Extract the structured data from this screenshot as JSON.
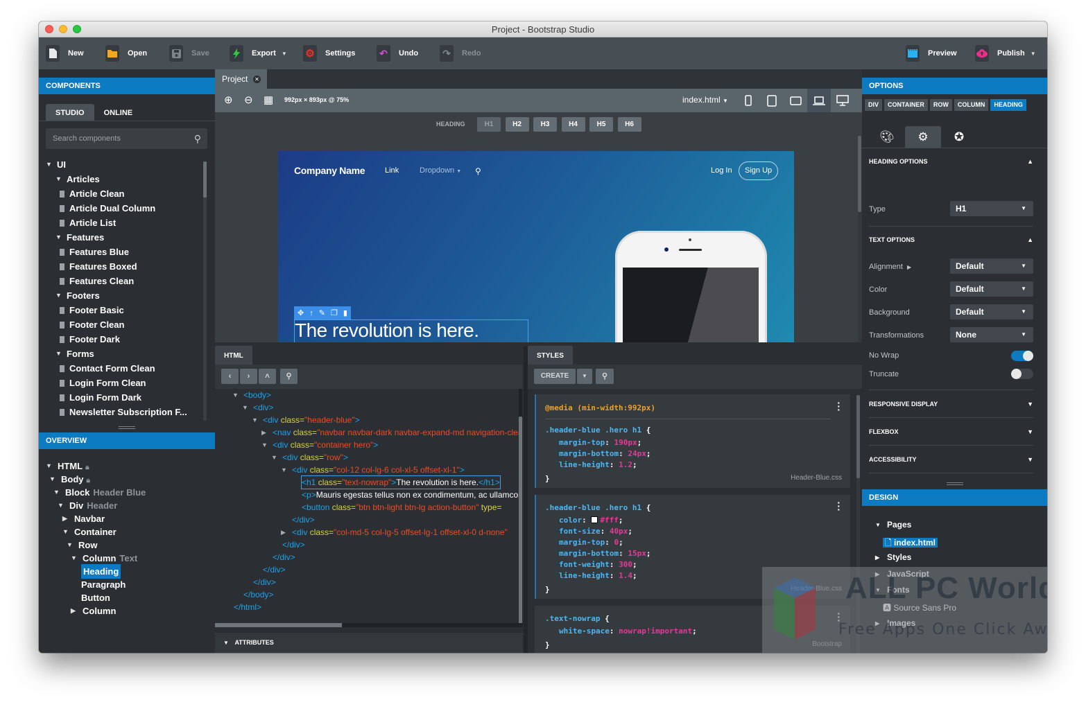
{
  "window": {
    "title": "Project - Bootstrap Studio"
  },
  "toolbar": {
    "new": "New",
    "open": "Open",
    "save": "Save",
    "export": "Export",
    "settings": "Settings",
    "undo": "Undo",
    "redo": "Redo",
    "preview": "Preview",
    "publish": "Publish",
    "colors": {
      "open": "#f5a623",
      "export": "#2ecc40",
      "settings": "#e8332a",
      "undo": "#d24bd6",
      "preview": "#2ab1f0",
      "publish": "#ec2f8b"
    }
  },
  "components": {
    "header": "COMPONENTS",
    "tabs": [
      "STUDIO",
      "ONLINE"
    ],
    "active_tab": "STUDIO",
    "search_placeholder": "Search components",
    "tree": [
      {
        "label": "UI",
        "level": 0,
        "type": "group"
      },
      {
        "label": "Articles",
        "level": 1,
        "type": "group"
      },
      {
        "label": "Article Clean",
        "level": 2,
        "type": "item"
      },
      {
        "label": "Article Dual Column",
        "level": 2,
        "type": "item"
      },
      {
        "label": "Article List",
        "level": 2,
        "type": "item"
      },
      {
        "label": "Features",
        "level": 1,
        "type": "group"
      },
      {
        "label": "Features Blue",
        "level": 2,
        "type": "item"
      },
      {
        "label": "Features Boxed",
        "level": 2,
        "type": "item"
      },
      {
        "label": "Features Clean",
        "level": 2,
        "type": "item"
      },
      {
        "label": "Footers",
        "level": 1,
        "type": "group"
      },
      {
        "label": "Footer Basic",
        "level": 2,
        "type": "item"
      },
      {
        "label": "Footer Clean",
        "level": 2,
        "type": "item"
      },
      {
        "label": "Footer Dark",
        "level": 2,
        "type": "item"
      },
      {
        "label": "Forms",
        "level": 1,
        "type": "group"
      },
      {
        "label": "Contact Form Clean",
        "level": 2,
        "type": "item"
      },
      {
        "label": "Login Form Clean",
        "level": 2,
        "type": "item"
      },
      {
        "label": "Login Form Dark",
        "level": 2,
        "type": "item"
      },
      {
        "label": "Newsletter Subscription F...",
        "level": 2,
        "type": "item"
      }
    ]
  },
  "overview": {
    "header": "OVERVIEW",
    "tree": [
      {
        "label": "HTML",
        "sub": "",
        "lock": true,
        "arrow": "down"
      },
      {
        "label": "Body",
        "sub": "",
        "lock": true,
        "arrow": "down"
      },
      {
        "label": "Block",
        "sub": "Header Blue",
        "lock": false,
        "arrow": "down"
      },
      {
        "label": "Div",
        "sub": "Header",
        "lock": false,
        "arrow": "down"
      },
      {
        "label": "Navbar",
        "sub": "",
        "lock": false,
        "arrow": "right"
      },
      {
        "label": "Container",
        "sub": "",
        "lock": false,
        "arrow": "down"
      },
      {
        "label": "Row",
        "sub": "",
        "lock": false,
        "arrow": "down"
      },
      {
        "label": "Column",
        "sub": "Text",
        "lock": false,
        "arrow": "down"
      },
      {
        "label": "Heading",
        "sub": "",
        "lock": false,
        "arrow": "",
        "selected": true
      },
      {
        "label": "Paragraph",
        "sub": "",
        "lock": false,
        "arrow": ""
      },
      {
        "label": "Button",
        "sub": "",
        "lock": false,
        "arrow": ""
      },
      {
        "label": "Column",
        "sub": "",
        "lock": false,
        "arrow": "right"
      }
    ]
  },
  "editor": {
    "doc_tab": "Project",
    "canvas_size": "992px × 893px @ 75%",
    "page_select": "index.html",
    "devices": [
      "phone",
      "tablet-portrait",
      "tablet-landscape",
      "laptop",
      "desktop"
    ],
    "active_device": "laptop",
    "heading_label": "HEADING",
    "heading_buttons": [
      "H1",
      "H2",
      "H3",
      "H4",
      "H5",
      "H6"
    ],
    "current_heading": "H1"
  },
  "preview": {
    "brand": "Company Name",
    "nav_links": [
      "Link",
      "Dropdown"
    ],
    "login": "Log In",
    "signup": "Sign Up",
    "headline": "The revolution is here.",
    "gradient": [
      "#1c3c85",
      "#1f8ab0"
    ]
  },
  "html_panel": {
    "tab": "HTML",
    "lines": [
      {
        "indent": 0,
        "arrow": "down",
        "parts": [
          [
            "tg",
            "<body>"
          ]
        ]
      },
      {
        "indent": 1,
        "arrow": "down",
        "parts": [
          [
            "tg",
            "<div>"
          ]
        ]
      },
      {
        "indent": 2,
        "arrow": "down",
        "parts": [
          [
            "tg",
            "<div "
          ],
          [
            "at",
            "class="
          ],
          [
            "av",
            "\"header-blue\""
          ],
          [
            "tg",
            ">"
          ]
        ]
      },
      {
        "indent": 3,
        "arrow": "right",
        "parts": [
          [
            "tg",
            "<nav "
          ],
          [
            "at",
            "class="
          ],
          [
            "av",
            "\"navbar navbar-dark navbar-expand-md navigation-clean-search\""
          ],
          [
            "tg",
            ">"
          ]
        ]
      },
      {
        "indent": 3,
        "arrow": "down",
        "parts": [
          [
            "tg",
            "<div "
          ],
          [
            "at",
            "class="
          ],
          [
            "av",
            "\"container hero\""
          ],
          [
            "tg",
            ">"
          ]
        ]
      },
      {
        "indent": 4,
        "arrow": "down",
        "parts": [
          [
            "tg",
            "<div "
          ],
          [
            "at",
            "class="
          ],
          [
            "av",
            "\"row\""
          ],
          [
            "tg",
            ">"
          ]
        ]
      },
      {
        "indent": 5,
        "arrow": "down",
        "parts": [
          [
            "tg",
            "<div "
          ],
          [
            "at",
            "class="
          ],
          [
            "av",
            "\"col-12 col-lg-6 col-xl-5 offset-xl-1\""
          ],
          [
            "tg",
            ">"
          ]
        ]
      },
      {
        "indent": 6,
        "arrow": "",
        "selected": true,
        "parts": [
          [
            "tg",
            "<h1 "
          ],
          [
            "at",
            "class="
          ],
          [
            "av",
            "\"text-nowrap\""
          ],
          [
            "tg",
            ">"
          ],
          [
            "tx",
            "The revolution is here."
          ],
          [
            "tg",
            "</h1>"
          ]
        ]
      },
      {
        "indent": 6,
        "arrow": "",
        "parts": [
          [
            "tg",
            "<p>"
          ],
          [
            "tx",
            "Mauris egestas tellus non ex condimentum, ac ullamcorper"
          ]
        ]
      },
      {
        "indent": 6,
        "arrow": "",
        "parts": [
          [
            "tg",
            "<button "
          ],
          [
            "at",
            "class="
          ],
          [
            "av",
            "\"btn btn-light btn-lg action-button\""
          ],
          [
            "at",
            " type="
          ]
        ]
      },
      {
        "indent": 5,
        "arrow": "",
        "parts": [
          [
            "tg",
            "</div>"
          ]
        ]
      },
      {
        "indent": 5,
        "arrow": "right",
        "parts": [
          [
            "tg",
            "<div "
          ],
          [
            "at",
            "class="
          ],
          [
            "av",
            "\"col-md-5 col-lg-5 offset-lg-1 offset-xl-0 d-none\""
          ]
        ]
      },
      {
        "indent": 4,
        "arrow": "",
        "parts": [
          [
            "tg",
            "</div>"
          ]
        ]
      },
      {
        "indent": 3,
        "arrow": "",
        "parts": [
          [
            "tg",
            "</div>"
          ]
        ]
      },
      {
        "indent": 2,
        "arrow": "",
        "parts": [
          [
            "tg",
            "</div>"
          ]
        ]
      },
      {
        "indent": 1,
        "arrow": "",
        "parts": [
          [
            "tg",
            "</div>"
          ]
        ]
      },
      {
        "indent": 0,
        "arrow": "",
        "parts": [
          [
            "tg",
            "</body>"
          ]
        ]
      },
      {
        "indent": -1,
        "arrow": "",
        "parts": [
          [
            "tg",
            "</html>"
          ]
        ]
      }
    ],
    "attributes_label": "ATTRIBUTES"
  },
  "styles_panel": {
    "tab": "STYLES",
    "create_label": "CREATE",
    "rules": [
      {
        "media": "@media (min-width:992px)",
        "selector": ".header-blue .hero h1",
        "declarations": [
          [
            "margin-top",
            "190px"
          ],
          [
            "margin-bottom",
            "24px"
          ],
          [
            "line-height",
            "1.2"
          ]
        ],
        "file": "Header-Blue.css"
      },
      {
        "media": "",
        "selector": ".header-blue .hero h1",
        "declarations": [
          [
            "color",
            "#fff"
          ],
          [
            "font-size",
            "40px"
          ],
          [
            "margin-top",
            "0"
          ],
          [
            "margin-bottom",
            "15px"
          ],
          [
            "font-weight",
            "300"
          ],
          [
            "line-height",
            "1.4"
          ]
        ],
        "file": "Header-Blue.css"
      },
      {
        "media": "",
        "selector": ".text-nowrap",
        "declarations": [
          [
            "white-space",
            "nowrap!important"
          ]
        ],
        "file": "Bootstrap"
      }
    ]
  },
  "options": {
    "header": "OPTIONS",
    "breadcrumbs": [
      "DIV",
      "CONTAINER",
      "ROW",
      "COLUMN",
      "HEADING"
    ],
    "active_breadcrumb": "HEADING",
    "tabs": [
      "palette",
      "gear",
      "star"
    ],
    "active_tab": "gear",
    "heading_options": "HEADING OPTIONS",
    "type_label": "Type",
    "type_value": "H1",
    "text_options": "TEXT OPTIONS",
    "alignment_label": "Alignment",
    "alignment_value": "Default",
    "color_label": "Color",
    "color_value": "Default",
    "background_label": "Background",
    "background_value": "Default",
    "transform_label": "Transformations",
    "transform_value": "None",
    "nowrap_label": "No Wrap",
    "nowrap_on": true,
    "truncate_label": "Truncate",
    "truncate_on": false,
    "collapsed_groups": [
      "RESPONSIVE DISPLAY",
      "FLEXBOX",
      "ACCESSIBILITY"
    ]
  },
  "design": {
    "header": "DESIGN",
    "tree": [
      {
        "label": "Pages",
        "arrow": "down",
        "level": 0
      },
      {
        "label": "index.html",
        "arrow": "",
        "level": 1,
        "selected": true,
        "icon": "file-icon"
      },
      {
        "label": "Styles",
        "arrow": "right",
        "level": 0
      },
      {
        "label": "JavaScript",
        "arrow": "right",
        "level": 0
      },
      {
        "label": "Fonts",
        "arrow": "down",
        "level": 0
      },
      {
        "label": "Source Sans Pro",
        "arrow": "",
        "level": 1,
        "icon": "font-file-icon"
      },
      {
        "label": "Images",
        "arrow": "right",
        "level": 0
      }
    ]
  },
  "watermark": {
    "title": "ALL PC World",
    "subtitle": "Free Apps One Click Away"
  }
}
